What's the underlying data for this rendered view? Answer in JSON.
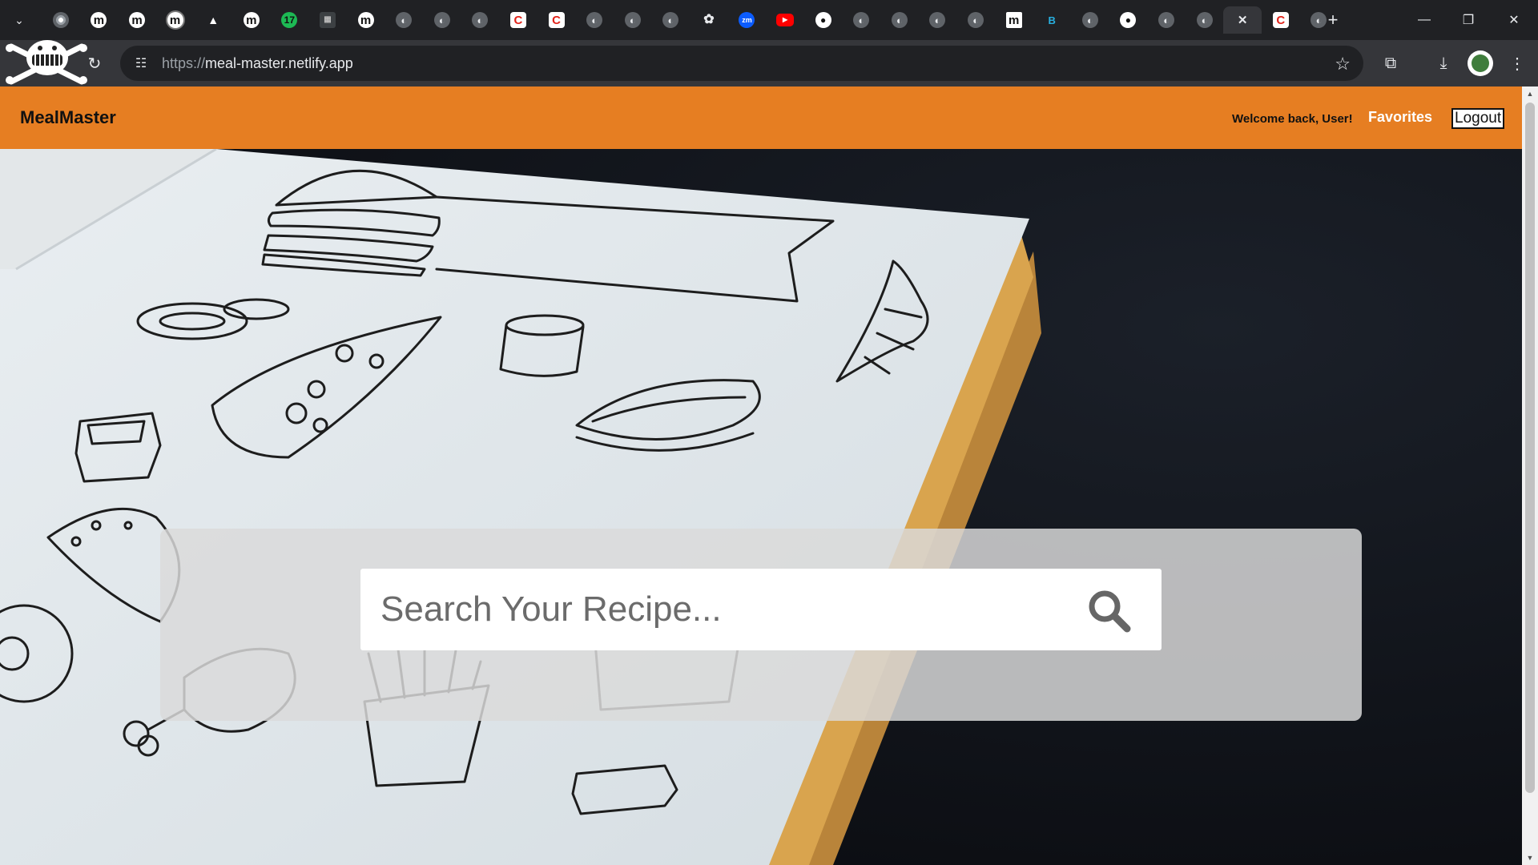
{
  "browser": {
    "tabs": [
      {
        "icon": "chrome-icon",
        "glyph": "",
        "style": "chrome",
        "active": false
      },
      {
        "icon": "medium-icon",
        "glyph": "m",
        "style": "medium",
        "active": false
      },
      {
        "icon": "medium-icon",
        "glyph": "m",
        "style": "medium",
        "active": false
      },
      {
        "icon": "medium-icon",
        "glyph": "m",
        "style": "medium ring",
        "active": false
      },
      {
        "icon": "drive-icon",
        "glyph": "▲",
        "style": "drive",
        "active": false
      },
      {
        "icon": "medium-icon",
        "glyph": "m",
        "style": "medium",
        "active": false
      },
      {
        "icon": "spotify-icon",
        "glyph": "17",
        "style": "spotify",
        "active": false
      },
      {
        "icon": "qr-grid-icon",
        "glyph": "▦",
        "style": "grid",
        "active": false
      },
      {
        "icon": "medium-icon",
        "glyph": "m",
        "style": "medium",
        "active": false
      },
      {
        "icon": "globe-icon",
        "glyph": "◐",
        "style": "globe",
        "active": false
      },
      {
        "icon": "globe-icon",
        "glyph": "◐",
        "style": "globe",
        "active": false
      },
      {
        "icon": "globe-icon",
        "glyph": "◐",
        "style": "globe",
        "active": false
      },
      {
        "icon": "codeforces-red-icon",
        "glyph": "C",
        "style": "red",
        "active": false
      },
      {
        "icon": "codeforces-red-icon",
        "glyph": "C",
        "style": "red",
        "active": false
      },
      {
        "icon": "globe-icon",
        "glyph": "◐",
        "style": "globe",
        "active": false
      },
      {
        "icon": "globe-icon",
        "glyph": "◐",
        "style": "globe",
        "active": false
      },
      {
        "icon": "globe-icon",
        "glyph": "◐",
        "style": "globe",
        "active": false
      },
      {
        "icon": "chatgpt-icon",
        "glyph": "✿",
        "style": "gpt",
        "active": false
      },
      {
        "icon": "zoom-icon",
        "glyph": "zm",
        "style": "zoom",
        "active": false
      },
      {
        "icon": "youtube-icon",
        "glyph": "▶",
        "style": "yt",
        "active": false
      },
      {
        "icon": "github-icon",
        "glyph": "●",
        "style": "gh",
        "active": false
      },
      {
        "icon": "globe-icon",
        "glyph": "◐",
        "style": "globe",
        "active": false
      },
      {
        "icon": "globe-icon",
        "glyph": "◐",
        "style": "globe",
        "active": false
      },
      {
        "icon": "globe-icon",
        "glyph": "◐",
        "style": "globe",
        "active": false
      },
      {
        "icon": "globe-icon",
        "glyph": "◐",
        "style": "globe",
        "active": false
      },
      {
        "icon": "medium-m-icon",
        "glyph": "m",
        "style": "mblack",
        "active": false
      },
      {
        "icon": "b-icon",
        "glyph": "B",
        "style": "b",
        "active": false
      },
      {
        "icon": "globe-icon",
        "glyph": "◐",
        "style": "globe",
        "active": false
      },
      {
        "icon": "github-icon",
        "glyph": "●",
        "style": "gh",
        "active": false
      },
      {
        "icon": "globe-icon",
        "glyph": "◐",
        "style": "globe",
        "active": false
      },
      {
        "icon": "globe-icon",
        "glyph": "◐",
        "style": "globe",
        "active": false
      },
      {
        "icon": "close-icon",
        "glyph": "✕",
        "style": "close",
        "active": true
      },
      {
        "icon": "codeforces-red-icon",
        "glyph": "C",
        "style": "red",
        "active": false
      },
      {
        "icon": "globe-icon",
        "glyph": "◐",
        "style": "globe",
        "active": false
      }
    ],
    "url_scheme": "https://",
    "url_host": "meal-master.netlify.app",
    "icons": {
      "tab_search": "chevron-down-icon",
      "new_tab": "plus-icon",
      "reload": "reload-icon",
      "site_info": "tune-icon",
      "bookmark": "star-icon",
      "extensions": "puzzle-icon",
      "downloads": "download-icon",
      "menu": "kebab-menu-icon"
    }
  },
  "navbar": {
    "brand": "MealMaster",
    "welcome": "Welcome back, User!",
    "favorites": "Favorites",
    "logout": "Logout",
    "color": "#e67e22"
  },
  "search": {
    "placeholder": "Search Your Recipe...",
    "value": "",
    "button_icon": "search-icon"
  }
}
